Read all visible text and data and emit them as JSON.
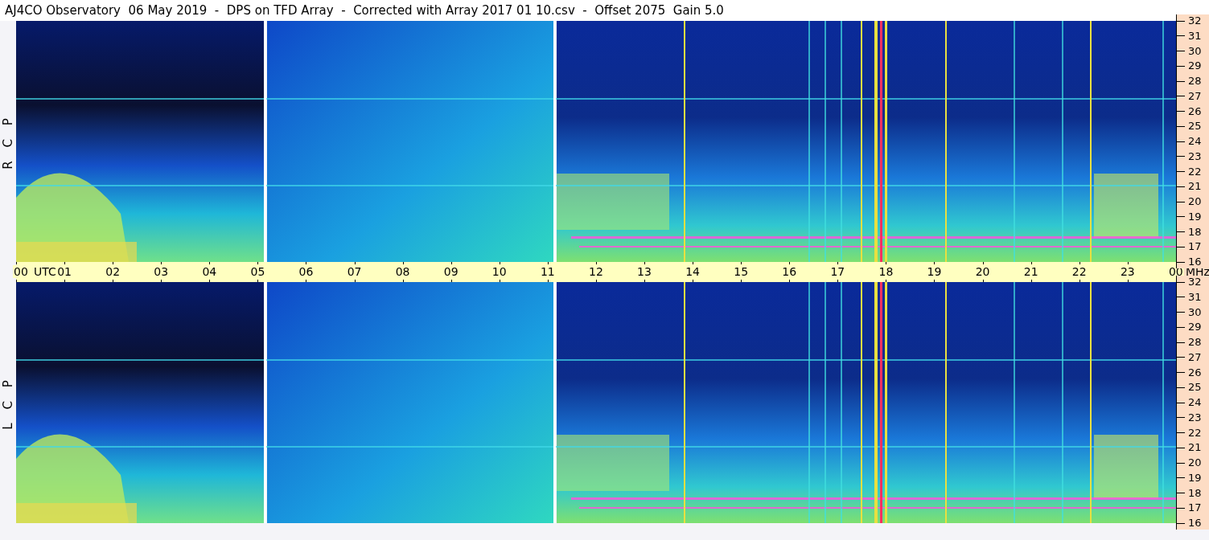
{
  "title": "AJ4CO Observatory  06 May 2019  -  DPS on TFD Array  -  Corrected with Array 2017 01 10.csv  -  Offset 2075  Gain 5.0",
  "panels": [
    {
      "polarization": "R C P",
      "mhz_ticks": [
        "32",
        "31",
        "30",
        "29",
        "28",
        "27",
        "26",
        "25",
        "24",
        "23",
        "22",
        "21",
        "20",
        "19",
        "18",
        "17",
        "16"
      ]
    },
    {
      "polarization": "L C P",
      "mhz_ticks": [
        "32",
        "31",
        "30",
        "29",
        "28",
        "27",
        "26",
        "25",
        "24",
        "23",
        "22",
        "21",
        "20",
        "19",
        "18",
        "17",
        "16"
      ]
    }
  ],
  "time_axis": {
    "zone": "UTC",
    "unit": "MHz",
    "ticks": [
      "00",
      "01",
      "02",
      "03",
      "04",
      "05",
      "06",
      "07",
      "08",
      "09",
      "10",
      "11",
      "12",
      "13",
      "14",
      "15",
      "16",
      "17",
      "18",
      "19",
      "20",
      "21",
      "22",
      "23",
      "00"
    ]
  }
}
